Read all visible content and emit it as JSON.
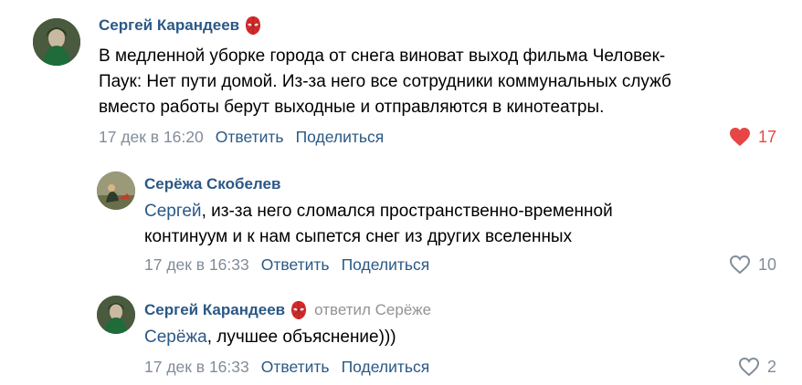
{
  "comments": [
    {
      "author": "Сергей Карандеев",
      "badge_icon": "spiderman-mask-icon",
      "text_lines": [
        "В медленной уборке города от снега виноват выход фильма Человек-",
        "Паук: Нет пути домой. Из-за него все сотрудники коммунальных служб",
        "вместо работы берут выходные и отправляются в кинотеатры."
      ],
      "date": "17 дек в 16:20",
      "reply_label": "Ответить",
      "share_label": "Поделиться",
      "likes": "17",
      "liked": true
    },
    {
      "author": "Серёжа Скобелев",
      "mention": "Сергей",
      "text_line1_rest": ", из-за него сломался пространственно-временной",
      "text_line2": "континуум и к нам сыпется снег из других вселенных",
      "date": "17 дек в 16:33",
      "reply_label": "Ответить",
      "share_label": "Поделиться",
      "likes": "10",
      "liked": false
    },
    {
      "author": "Сергей Карандеев",
      "badge_icon": "spiderman-mask-icon",
      "replied_to": "ответил Серёже",
      "mention": "Серёжа",
      "text_rest": ", лучшее объяснение)))",
      "date": "17 дек в 16:33",
      "reply_label": "Ответить",
      "share_label": "Поделиться",
      "likes": "2",
      "liked": false
    }
  ],
  "colors": {
    "link": "#2a5885",
    "meta": "#818c99",
    "like_active": "#e64646"
  }
}
